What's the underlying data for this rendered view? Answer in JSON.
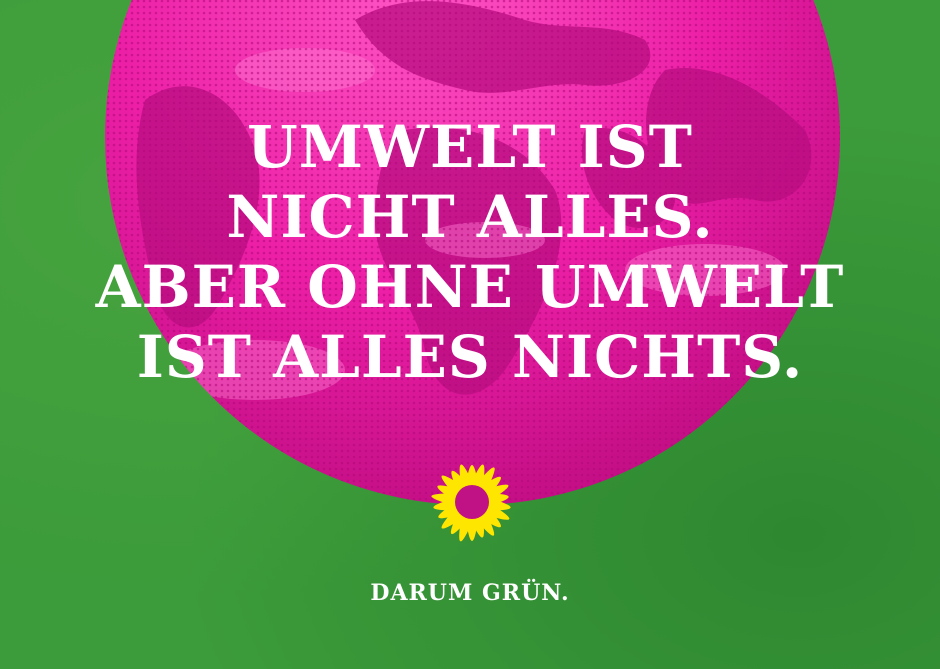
{
  "poster": {
    "headline_lines": [
      "UMWELT IST",
      "NICHT ALLES.",
      "ABER OHNE UMWELT",
      "IST ALLES NICHTS."
    ],
    "claim": "DARUM GRÜN.",
    "logo_icon": "sunflower-icon",
    "illustration": "earth-globe",
    "colors": {
      "background_green": "#3c9b3a",
      "globe_magenta": "#ec1fa6",
      "text": "#ffffff",
      "sunflower_yellow": "#ffe600"
    }
  }
}
